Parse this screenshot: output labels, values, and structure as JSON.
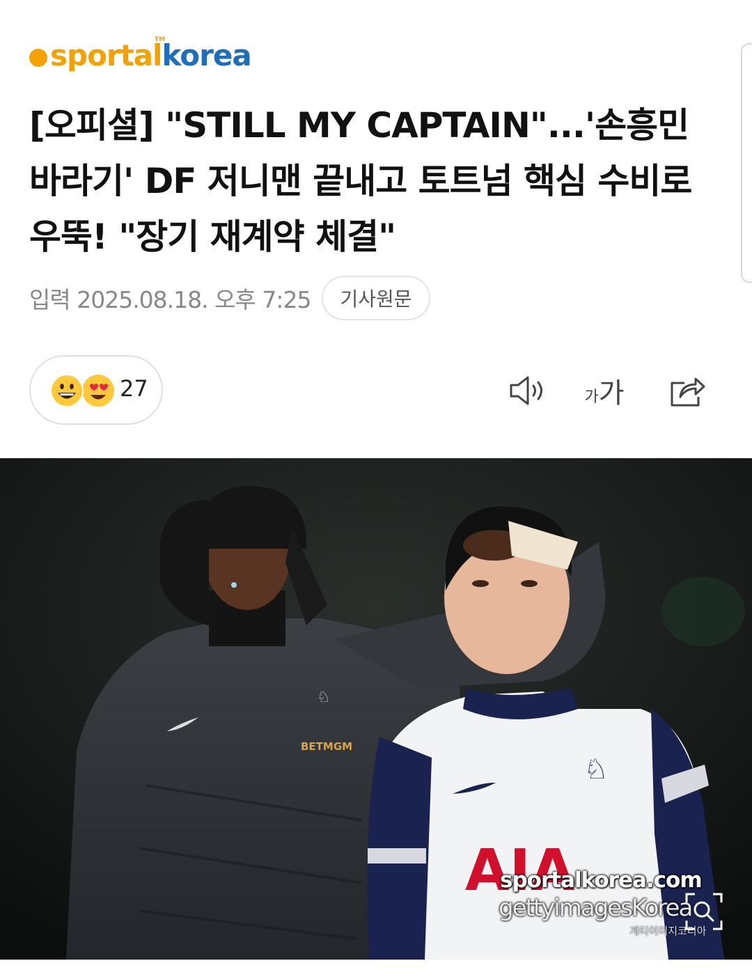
{
  "header": {
    "logo_prefix": "sport",
    "logo_middle": "al",
    "logo_suffix": "korea",
    "logo_tm": "TM"
  },
  "article": {
    "headline": "[오피셜] \"STILL MY CAPTAIN\"...'손흥민 바라기' DF 저니맨 끝내고 토트넘 핵심 수비로 우뚝! \"장기 재계약 체결\"",
    "date": "입력 2025.08.18. 오후 7:25",
    "origin_label": "기사원문"
  },
  "reactions": {
    "count": "27",
    "emojis": [
      "grinning-face",
      "heart-eyes-face"
    ]
  },
  "toolbar": {
    "audio_icon": "speaker-icon",
    "font_small": "가",
    "font_large": "가",
    "share_icon": "share-icon"
  },
  "photo": {
    "description_icon": "photo",
    "watermark_1": "sportalkorea.com",
    "watermark_2": "gettyimagesKorea",
    "watermark_3": "게티이미지코리아",
    "jersey_sponsor": "AIA",
    "jacket_sponsor": "BETMGM",
    "zoom_icon": "zoom-magnifier-icon"
  },
  "colors": {
    "logo_orange": "#f5a100",
    "logo_blue": "#1e6ec0",
    "meta_gray": "#888888",
    "jersey_red": "#d3102b",
    "jersey_navy": "#1a2350"
  }
}
